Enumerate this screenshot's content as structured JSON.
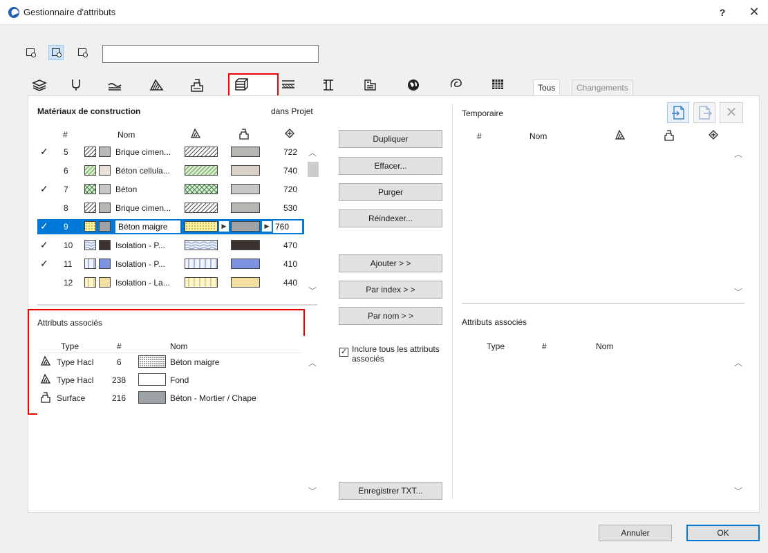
{
  "window": {
    "title": "Gestionnaire d'attributs",
    "help": "?",
    "close": "✕"
  },
  "filter": {
    "search_value": "",
    "search_placeholder": ""
  },
  "tabs": {
    "icons": [
      "layers-icon",
      "pen-icon",
      "line-type-icon",
      "fill-icon",
      "surface-icon",
      "building-material-icon",
      "composite-icon",
      "profile-icon",
      "zone-icon",
      "globe-icon",
      "markup-icon",
      "grid-icon"
    ],
    "text_tabs": [
      "Tous",
      "Changements"
    ],
    "selected": "building-material-icon"
  },
  "left": {
    "header": "Matériaux de construction",
    "scope": "dans Projet",
    "columns": {
      "num": "#",
      "name": "Nom"
    },
    "rows": [
      {
        "checked": "✓",
        "num": "5",
        "name": "Brique cimen...",
        "value": "722",
        "c1": "#ffffff",
        "c2": "#b8b8b8",
        "fill": "#b8b6b2",
        "hatch": "diag"
      },
      {
        "checked": "",
        "num": "6",
        "name": "Béton cellula...",
        "value": "740",
        "c1": "#d8ecd0",
        "c2": "#e8e0d8",
        "fill": "#d9d0c7",
        "hatch": "diag-green"
      },
      {
        "checked": "✓",
        "num": "7",
        "name": "Béton",
        "value": "720",
        "c1": "#e0f2e0",
        "c2": "#c8c8c8",
        "fill": "#c8c8c8",
        "hatch": "cross"
      },
      {
        "checked": "",
        "num": "8",
        "name": "Brique cimen...",
        "value": "530",
        "c1": "#ffffff",
        "c2": "#b8b6b2",
        "fill": "#b8b6b2",
        "hatch": "diag"
      },
      {
        "checked": "✓",
        "num": "9",
        "name": "Béton maigre",
        "value": "760",
        "c1": "#fff3a0",
        "c2": "#9ea3a8",
        "fill": "#9ea3a8",
        "hatch": "dots",
        "selected": true
      },
      {
        "checked": "✓",
        "num": "10",
        "name": "Isolation - P...",
        "value": "470",
        "c1": "#e8eef8",
        "c2": "#3c3230",
        "fill": "#3c3230",
        "hatch": "waves"
      },
      {
        "checked": "✓",
        "num": "11",
        "name": "Isolation - P...",
        "value": "410",
        "c1": "#f0f4ff",
        "c2": "#7b93e0",
        "fill": "#7b93e0",
        "hatch": "vert"
      },
      {
        "checked": "",
        "num": "12",
        "name": "Isolation - La...",
        "value": "440",
        "c1": "#fff7d0",
        "c2": "#f3e0a0",
        "fill": "#f3e0a0",
        "hatch": "vert-yellow"
      }
    ]
  },
  "left_assoc": {
    "header": "Attributs associés",
    "columns": {
      "type": "Type",
      "num": "#",
      "name": "Nom"
    },
    "rows": [
      {
        "icon": "fill-type-icon",
        "type": "Type Hacl",
        "num": "6",
        "name": "Béton maigre",
        "swatch": "dots"
      },
      {
        "icon": "fill-type-icon",
        "type": "Type Hacl",
        "num": "238",
        "name": "Fond",
        "swatch": "blank"
      },
      {
        "icon": "surface-icon",
        "type": "Surface",
        "num": "216",
        "name": "Béton - Mortier / Chape",
        "swatch": "grey"
      }
    ]
  },
  "middle": {
    "duplicate": "Dupliquer",
    "delete": "Effacer...",
    "purge": "Purger",
    "reindex": "Réindexer...",
    "add": "Ajouter > >",
    "by_index": "Par index > >",
    "by_name": "Par nom > >",
    "include_label": "Inclure tous les attributs associés",
    "include_checked": true,
    "save_txt": "Enregistrer TXT..."
  },
  "right": {
    "header": "Temporaire",
    "columns": {
      "num": "#",
      "name": "Nom"
    },
    "assoc_header": "Attributs associés",
    "assoc_columns": {
      "type": "Type",
      "num": "#",
      "name": "Nom"
    }
  },
  "footer": {
    "cancel": "Annuler",
    "ok": "OK"
  }
}
